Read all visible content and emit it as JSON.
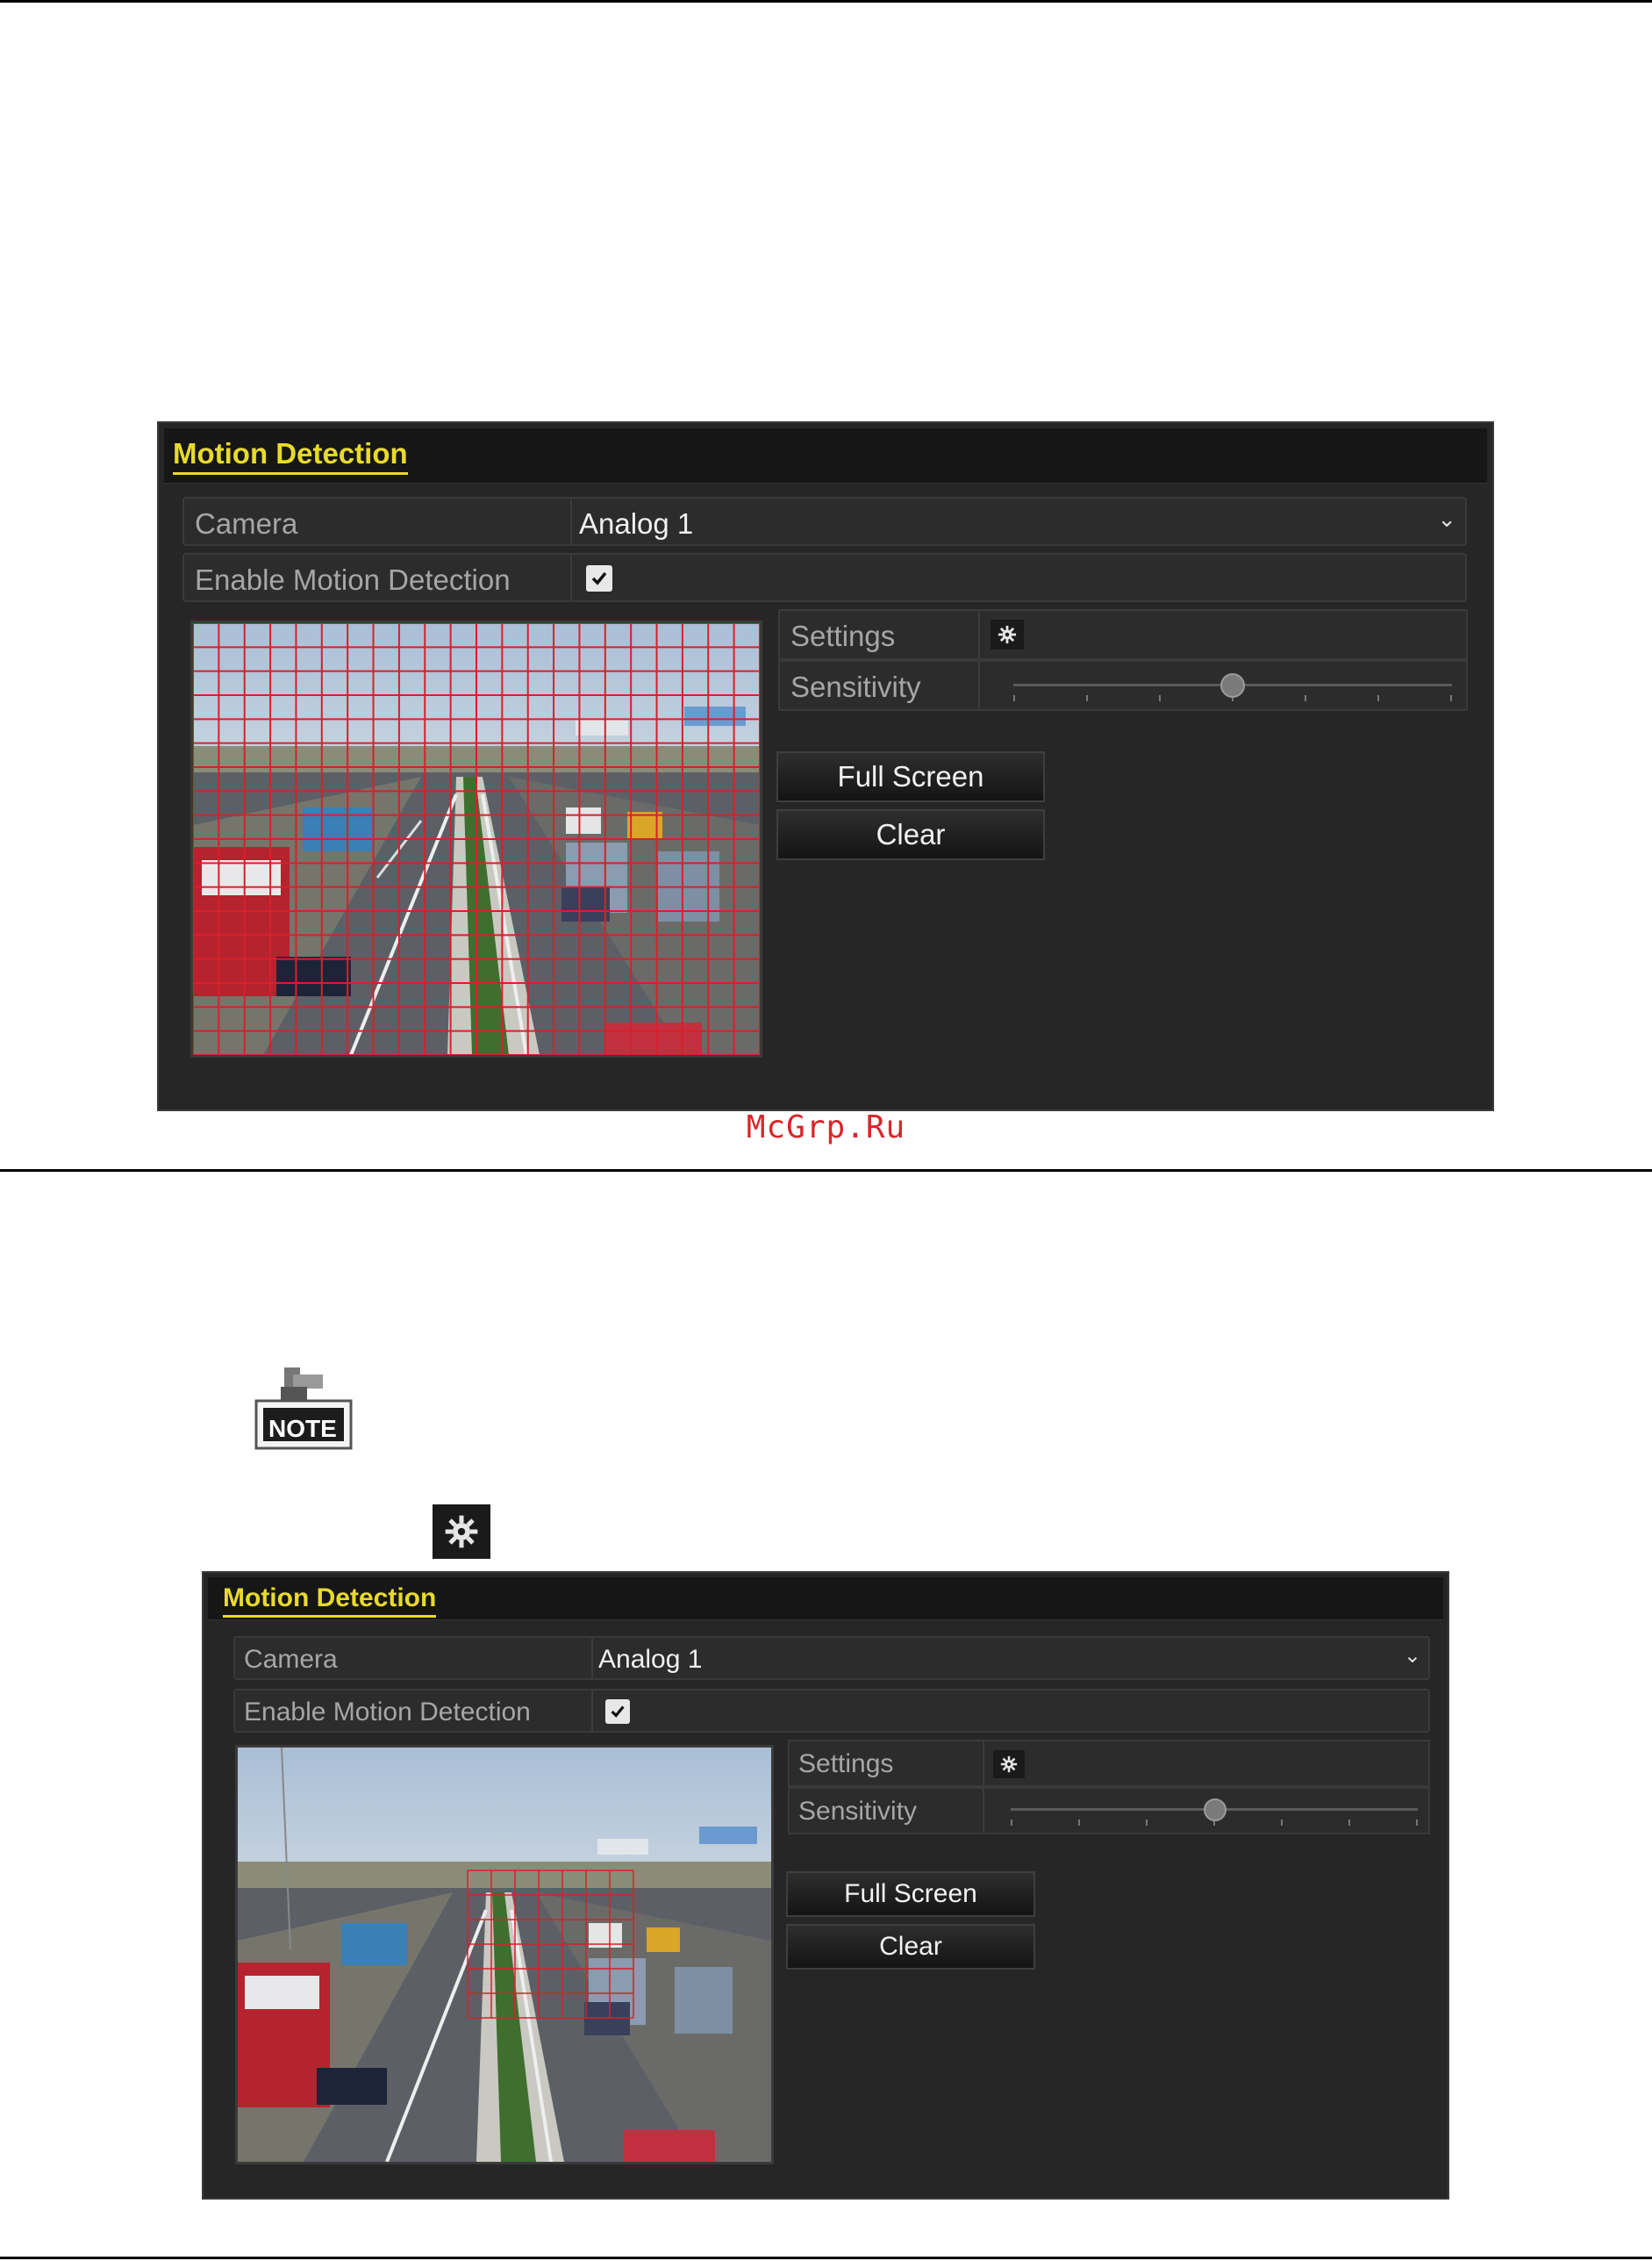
{
  "watermark": "McGrp.Ru",
  "note_icon": {
    "label": "NOTE"
  },
  "settings_button_icon": "gear-icon",
  "colors": {
    "panel_bg": "#262626",
    "panel_header_bg": "#161616",
    "title_accent": "#e8da2c",
    "grid_red": "#d8202a",
    "watermark_red": "#d8262a"
  },
  "screen1": {
    "title": "Motion Detection",
    "camera_label": "Camera",
    "camera_value": "Analog 1",
    "enable_label": "Enable Motion Detection",
    "enable_checked": true,
    "settings_label": "Settings",
    "sensitivity_label": "Sensitivity",
    "sensitivity_level": 0.5,
    "full_screen_label": "Full Screen",
    "clear_label": "Clear",
    "motion_area": "full-grid"
  },
  "screen2": {
    "title": "Motion Detection",
    "camera_label": "Camera",
    "camera_value": "Analog 1",
    "enable_label": "Enable Motion Detection",
    "enable_checked": true,
    "settings_label": "Settings",
    "sensitivity_label": "Sensitivity",
    "sensitivity_level": 0.5,
    "full_screen_label": "Full Screen",
    "clear_label": "Clear",
    "motion_area": "partial"
  }
}
